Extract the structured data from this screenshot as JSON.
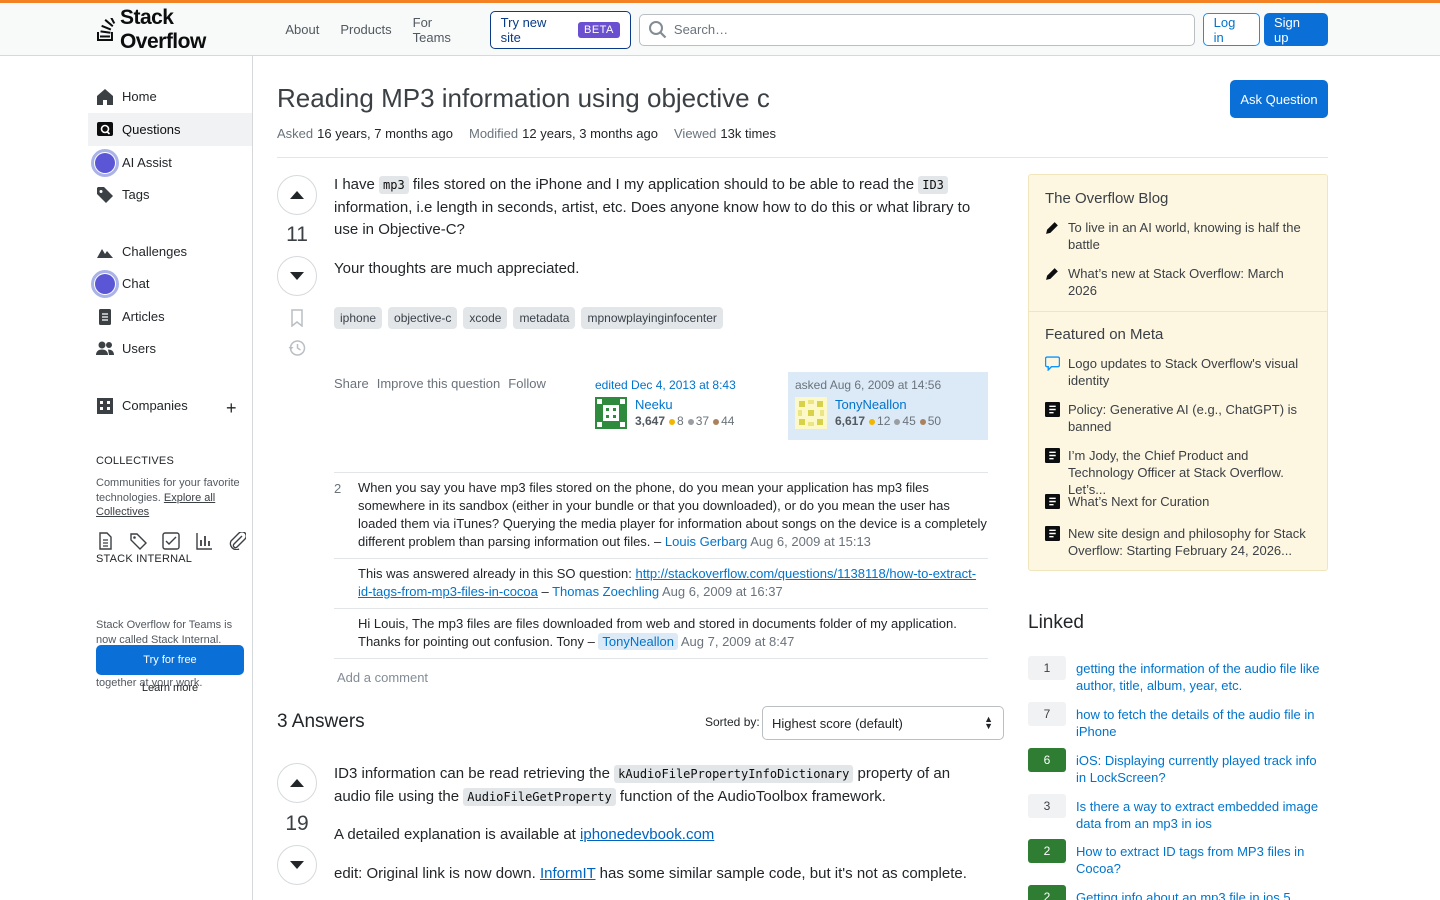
{
  "header": {
    "logo_text": "Stack Overflow",
    "nav": [
      "About",
      "Products",
      "For Teams"
    ],
    "try_site": "Try new site",
    "beta": "BETA",
    "search_placeholder": "Search…",
    "login": "Log in",
    "signup": "Sign up"
  },
  "leftnav": {
    "items": [
      "Home",
      "Questions",
      "AI Assist",
      "Tags",
      "Challenges",
      "Chat",
      "Articles",
      "Users",
      "Companies"
    ],
    "collectives_title": "COLLECTIVES",
    "collectives_text": "Communities for your favorite technologies.",
    "collectives_link": "Explore all Collectives",
    "internal_title": "STACK INTERNAL",
    "internal_text": "Stack Overflow for Teams is now called Stack Internal. Bring the best of human thought and AI automation together at your work.",
    "try_free": "Try for free",
    "learn_more": "Learn more"
  },
  "question": {
    "title": "Reading MP3 information using objective c",
    "ask_button": "Ask Question",
    "asked_label": "Asked",
    "asked_value": "16 years, 7 months ago",
    "modified_label": "Modified",
    "modified_value": "12 years, 3 months ago",
    "viewed_label": "Viewed",
    "viewed_value": "13k times",
    "score": "11",
    "body_p1_a": "I have ",
    "body_code1": "mp3",
    "body_p1_b": " files stored on the iPhone and I my application should to be able to read the ",
    "body_code2": "ID3",
    "body_p1_c": " information, i.e length in seconds, artist, etc. Does anyone know how to do this or what library to use in Objective-C?",
    "body_p2": "Your thoughts are much appreciated.",
    "tags": [
      "iphone",
      "objective-c",
      "xcode",
      "metadata",
      "mpnowplayinginfocenter"
    ],
    "menu": [
      "Share",
      "Improve this question",
      "Follow"
    ],
    "editor": {
      "action": "edited Dec 4, 2013 at 8:43",
      "name": "Neeku",
      "rep": "3,647",
      "gold": "8",
      "silver": "37",
      "bronze": "44"
    },
    "owner": {
      "action": "asked Aug 6, 2009 at 14:56",
      "name": "TonyNeallon",
      "rep": "6,617",
      "gold": "12",
      "silver": "45",
      "bronze": "50"
    }
  },
  "comments": [
    {
      "score": "2",
      "text": "When you say you have mp3 files stored on the phone, do you mean your application has mp3 files somewhere in its sandbox (either in your bundle or that you downloaded), or do you mean the user has loaded them via iTunes? Querying the media player for information about songs on the device is a completely different problem than parsing information out files. – ",
      "user": "Louis Gerbarg",
      "date": "Aug 6, 2009 at 15:13"
    },
    {
      "score": "",
      "text": "This was answered already in this SO question: ",
      "link": "http://stackoverflow.com/questions/1138118/how-to-extract-id-tags-from-mp3-files-in-cocoa",
      "text2": " – ",
      "user": "Thomas Zoechling",
      "date": "Aug 6, 2009 at 16:37"
    },
    {
      "score": "",
      "text": "Hi Louis, The mp3 files are files downloaded from web and stored in documents folder of my application. Thanks for pointing out confusion. Tony – ",
      "user": "TonyNeallon",
      "date": "Aug 7, 2009 at 8:47"
    }
  ],
  "add_comment": "Add a comment",
  "answers": {
    "heading": "3 Answers",
    "sorted_label": "Sorted by:",
    "sort_value": "Highest score (default)",
    "first": {
      "score": "19",
      "p1_a": "ID3 information can be read retrieving the ",
      "p1_code1": "kAudioFilePropertyInfoDictionary",
      "p1_b": " property of an audio file using the ",
      "p1_code2": "AudioFileGetProperty",
      "p1_c": " function of the AudioToolbox framework.",
      "p2_a": "A detailed explanation is available at ",
      "p2_link": "iphonedevbook.com",
      "p3_a": "edit: Original link is now down. ",
      "p3_link": "InformIT",
      "p3_b": " has some similar sample code, but it's not as complete."
    }
  },
  "blog": {
    "title": "The Overflow Blog",
    "items": [
      "To live in an AI world, knowing is half the battle",
      "What’s new at Stack Overflow: March 2026"
    ],
    "meta_title": "Featured on Meta",
    "meta_items": [
      "Logo updates to Stack Overflow's visual identity",
      "Policy: Generative AI (e.g., ChatGPT) is banned",
      "I’m Jody, the Chief Product and Technology Officer at Stack Overflow. Let’s...",
      "What’s Next for Curation",
      "New site design and philosophy for Stack Overflow: Starting February 24, 2026..."
    ]
  },
  "linked": {
    "title": "Linked",
    "items": [
      {
        "score": "1",
        "accepted": false,
        "text": "getting the information of the audio file like author, title, album, year, etc."
      },
      {
        "score": "7",
        "accepted": false,
        "text": "how to fetch the details of the audio file in iPhone"
      },
      {
        "score": "6",
        "accepted": true,
        "text": "iOS: Displaying currently played track info in LockScreen?"
      },
      {
        "score": "3",
        "accepted": false,
        "text": "Is there a way to extract embedded image data from an mp3 in ios"
      },
      {
        "score": "2",
        "accepted": true,
        "text": "How to extract ID tags from MP3 files in Cocoa?"
      },
      {
        "score": "2",
        "accepted": true,
        "text": "Getting info about an mp3 file in ios 5"
      }
    ]
  }
}
